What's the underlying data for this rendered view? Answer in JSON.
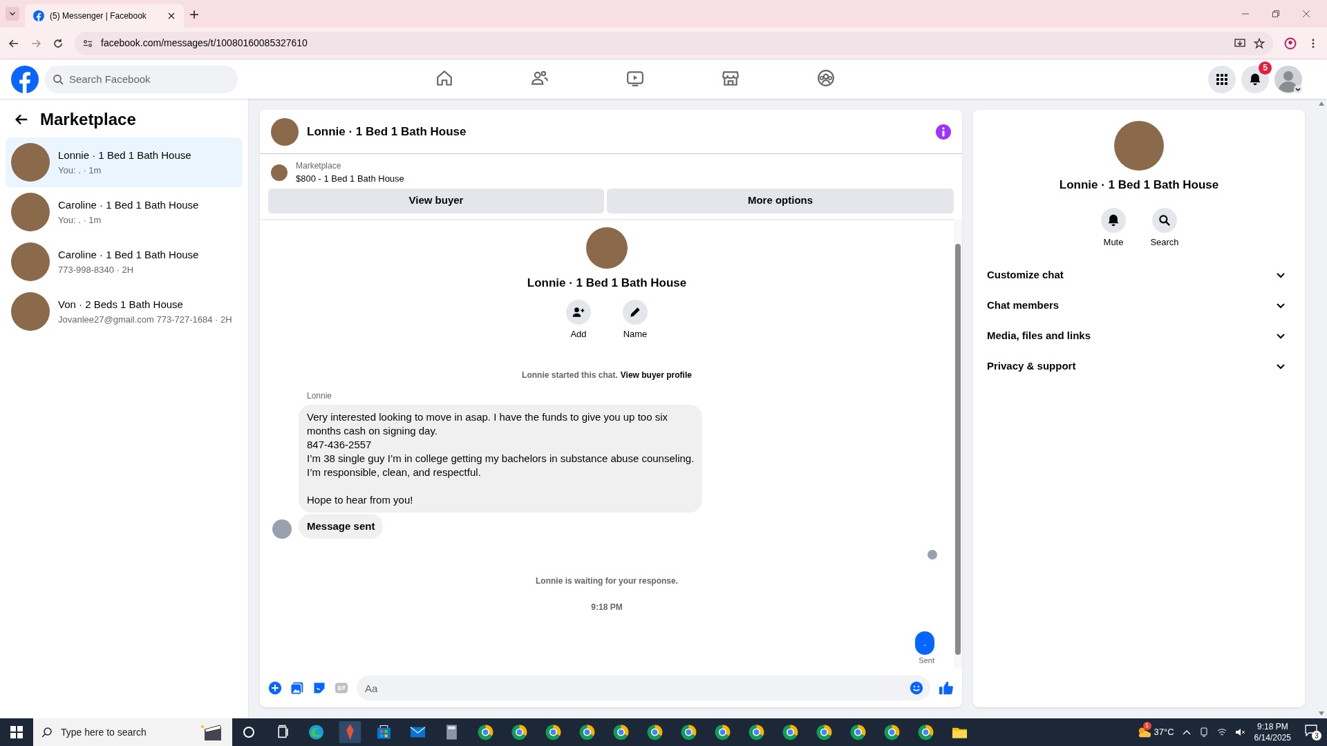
{
  "browser": {
    "tab_title": "(5) Messenger | Facebook",
    "url": "facebook.com/messages/t/10080160085327610"
  },
  "header": {
    "search": {
      "placeholder": "Search Facebook"
    },
    "nav": [
      {
        "kind": "home",
        "selected": false
      },
      {
        "kind": "friends",
        "selected": false
      },
      {
        "kind": "video",
        "selected": false
      },
      {
        "kind": "marketplace",
        "selected": false
      },
      {
        "kind": "groups",
        "selected": false
      }
    ],
    "notification_count": "5"
  },
  "sidebar": {
    "title": "Marketplace",
    "conversations": [
      {
        "name": "Lonnie · 1 Bed 1 Bath House",
        "snippet": "You: . · 1m",
        "selected": true
      },
      {
        "name": "Caroline · 1 Bed 1 Bath House",
        "snippet": "You: . · 1m",
        "selected": false
      },
      {
        "name": "Caroline · 1 Bed 1 Bath House",
        "snippet": "773-998-8340 · 2H",
        "selected": false
      },
      {
        "name": "Von · 2 Beds 1 Bath House",
        "snippet": "Jovanlee27@gmail.com 773-727-1684 · 2H",
        "selected": false
      }
    ]
  },
  "chat": {
    "title": "Lonnie · 1 Bed 1 Bath House",
    "listing": {
      "source": "Marketplace",
      "title": "$800 - 1 Bed 1 Bath House"
    },
    "buttons": [
      "View buyer",
      "More options"
    ],
    "profile": {
      "name": "Lonnie · 1 Bed 1 Bath House",
      "actions": [
        {
          "kind": "add",
          "label": "Add"
        },
        {
          "kind": "name",
          "label": "Name"
        }
      ]
    },
    "notice": {
      "text": "Lonnie started this chat.",
      "link": "View buyer profile"
    },
    "messages": [
      {
        "kind": "incoming",
        "sender": "Lonnie",
        "text": "Very interested looking to move in asap. I have the funds to give you up too six\nmonths cash on signing day.\n847-436-2557\nI’m 38 single guy I’m in college getting my bachelors in substance abuse counseling.\nI’m responsible, clean, and respectful.\n\nHope to hear from you!"
      },
      {
        "kind": "incoming_bold",
        "text": "Message sent"
      }
    ],
    "status": "Lonnie is waiting for your response.",
    "time": "9:18 PM",
    "outgoing": {
      "text": ".",
      "status": "Sent"
    },
    "composer": {
      "placeholder": "Aa"
    }
  },
  "details": {
    "name": "Lonnie · 1 Bed 1 Bath House",
    "actions": [
      {
        "kind": "mute",
        "label": "Mute"
      },
      {
        "kind": "search",
        "label": "Search"
      }
    ],
    "sections": [
      {
        "label": "Customize chat",
        "expanded": false
      },
      {
        "label": "Chat members",
        "expanded": false
      },
      {
        "label": "Media, files and links",
        "expanded": false
      },
      {
        "label": "Privacy & support",
        "expanded": false
      }
    ]
  },
  "taskbar": {
    "search_placeholder": "Type here to search",
    "apps": [
      {
        "kind": "taskview"
      },
      {
        "kind": "edge"
      },
      {
        "kind": "app"
      },
      {
        "kind": "store"
      },
      {
        "kind": "mail"
      },
      {
        "kind": "calculator"
      },
      {
        "kind": "chrome"
      },
      {
        "kind": "chrome"
      },
      {
        "kind": "chrome"
      },
      {
        "kind": "chrome"
      },
      {
        "kind": "chrome"
      },
      {
        "kind": "chrome"
      },
      {
        "kind": "chrome"
      },
      {
        "kind": "chrome"
      },
      {
        "kind": "chrome"
      },
      {
        "kind": "chrome"
      },
      {
        "kind": "chrome"
      },
      {
        "kind": "chrome"
      },
      {
        "kind": "chrome"
      },
      {
        "kind": "chrome"
      },
      {
        "kind": "explorer"
      }
    ],
    "weather_badge": "1",
    "temperature": "37°C",
    "time": "9:18 PM",
    "date": "6/14/2025",
    "notifications": "3"
  }
}
